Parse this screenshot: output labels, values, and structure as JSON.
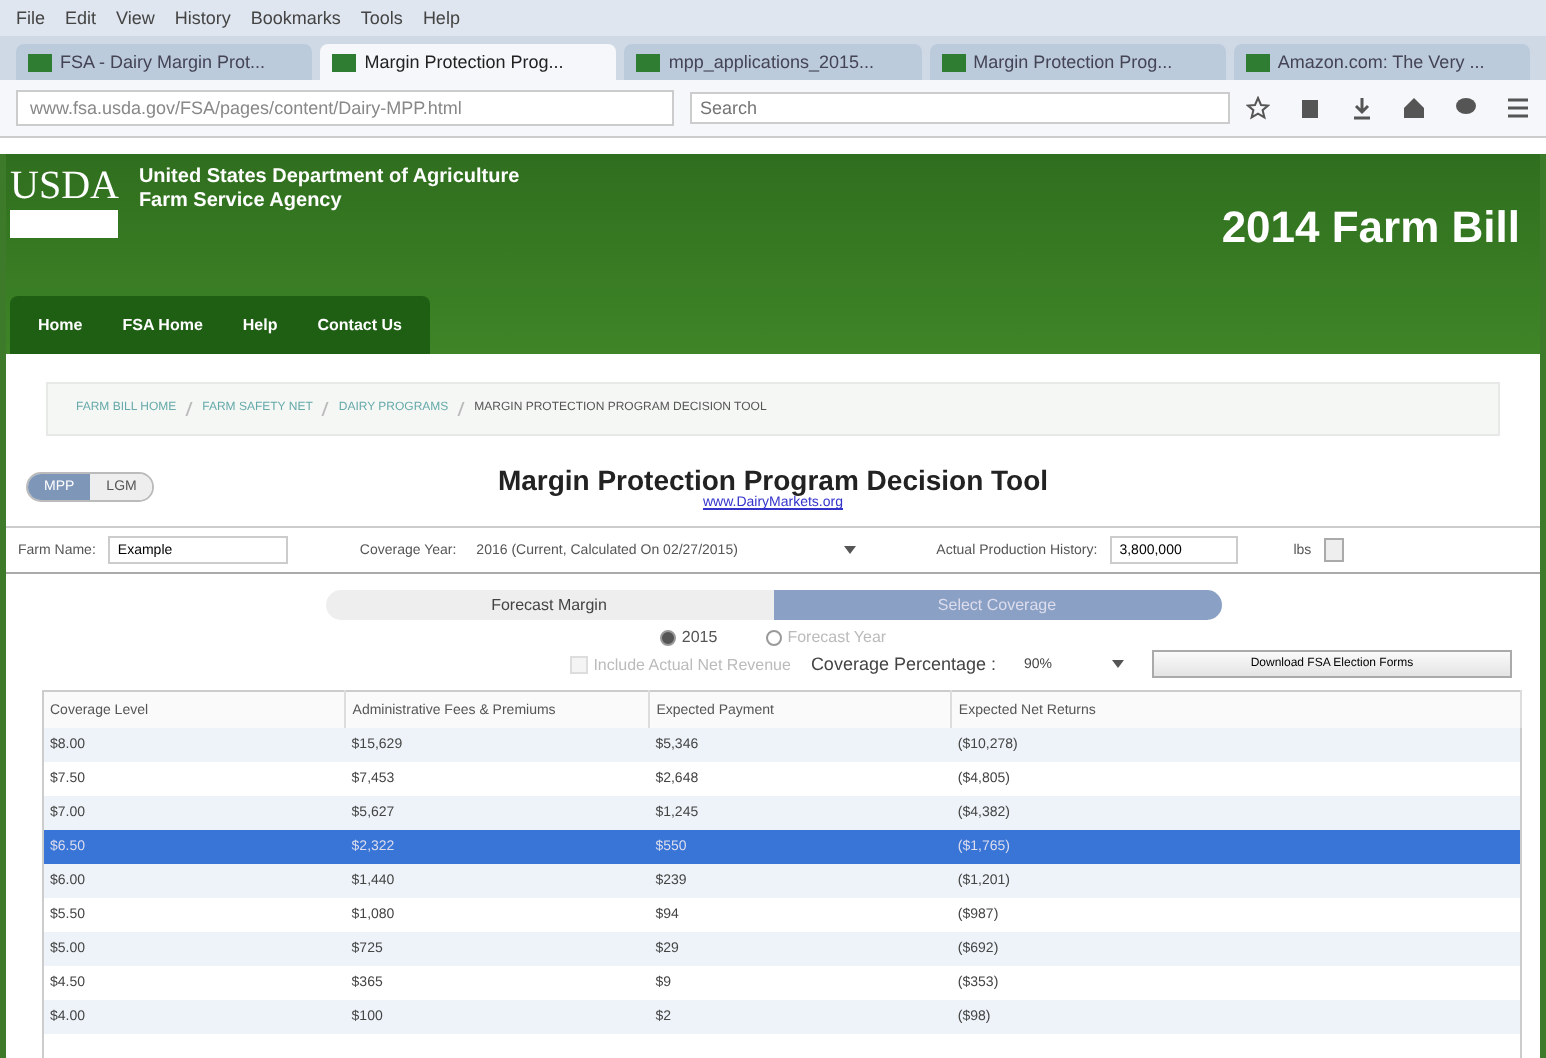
{
  "browser": {
    "menu": [
      "File",
      "Edit",
      "View",
      "History",
      "Bookmarks",
      "Tools",
      "Help"
    ],
    "tabs": [
      {
        "label": "FSA - Dairy Margin Prot...",
        "selected": false
      },
      {
        "label": "Margin Protection Prog...",
        "selected": true
      },
      {
        "label": "mpp_applications_2015...",
        "selected": false
      },
      {
        "label": "Margin Protection Prog...",
        "selected": false
      },
      {
        "label": "Amazon.com: The Very ...",
        "selected": false
      }
    ],
    "url": "www.fsa.usda.gov/FSA/pages/content/Dairy-MPP.html",
    "search": {
      "placeholder": "Search"
    }
  },
  "header": {
    "logo": "USDA",
    "agency": "United States Department of Agriculture",
    "sub_agency": "Farm Service Agency",
    "title": "2014 Farm Bill"
  },
  "nav": [
    "Home",
    "FSA Home",
    "Help",
    "Contact Us"
  ],
  "breadcrumb": [
    "FARM BILL HOME",
    "FARM SAFETY NET",
    "DAIRY PROGRAMS",
    "MARGIN PROTECTION PROGRAM DECISION TOOL"
  ],
  "program_toggle": [
    {
      "label": "MPP",
      "selected": true
    },
    {
      "label": "LGM",
      "selected": false
    }
  ],
  "tool": {
    "title": "Margin Protection Program Decision Tool",
    "link": "www.DairyMarkets.org"
  },
  "farm": {
    "name_label": "Farm Name:",
    "name_value": "Example",
    "year_label": "Coverage Year:",
    "year_value": "2016 (Current, Calculated On 02/27/2015)",
    "aph_label": "Actual Production History:",
    "aph_value": "3,800,000",
    "unit": "lbs"
  },
  "steps": [
    {
      "label": "Forecast Margin",
      "selected": false
    },
    {
      "label": "Select Coverage",
      "selected": true
    }
  ],
  "years": [
    {
      "label": "2015",
      "selected": true
    },
    {
      "label": "Forecast Year",
      "selected": false
    }
  ],
  "include_revenue": {
    "label": "Include Actual Net Revenue",
    "checked": false,
    "disabled": true
  },
  "coverage_percentage": {
    "label": "Coverage Percentage :",
    "value": "90%"
  },
  "download_button": "Download FSA Election Forms",
  "table": {
    "columns": [
      "Coverage Level",
      "Administrative Fees & Premiums",
      "Expected Payment",
      "Expected Net Returns"
    ],
    "rows": [
      {
        "cells": [
          "$8.00",
          "$15,629",
          "$5,346",
          "($10,278)"
        ],
        "selected": false
      },
      {
        "cells": [
          "$7.50",
          "$7,453",
          "$2,648",
          "($4,805)"
        ],
        "selected": false
      },
      {
        "cells": [
          "$7.00",
          "$5,627",
          "$1,245",
          "($4,382)"
        ],
        "selected": false
      },
      {
        "cells": [
          "$6.50",
          "$2,322",
          "$550",
          "($1,765)"
        ],
        "selected": true
      },
      {
        "cells": [
          "$6.00",
          "$1,440",
          "$239",
          "($1,201)"
        ],
        "selected": false
      },
      {
        "cells": [
          "$5.50",
          "$1,080",
          "$94",
          "($987)"
        ],
        "selected": false
      },
      {
        "cells": [
          "$5.00",
          "$725",
          "$29",
          "($692)"
        ],
        "selected": false
      },
      {
        "cells": [
          "$4.50",
          "$365",
          "$9",
          "($353)"
        ],
        "selected": false
      },
      {
        "cells": [
          "$4.00",
          "$100",
          "$2",
          "($98)"
        ],
        "selected": false
      }
    ]
  }
}
